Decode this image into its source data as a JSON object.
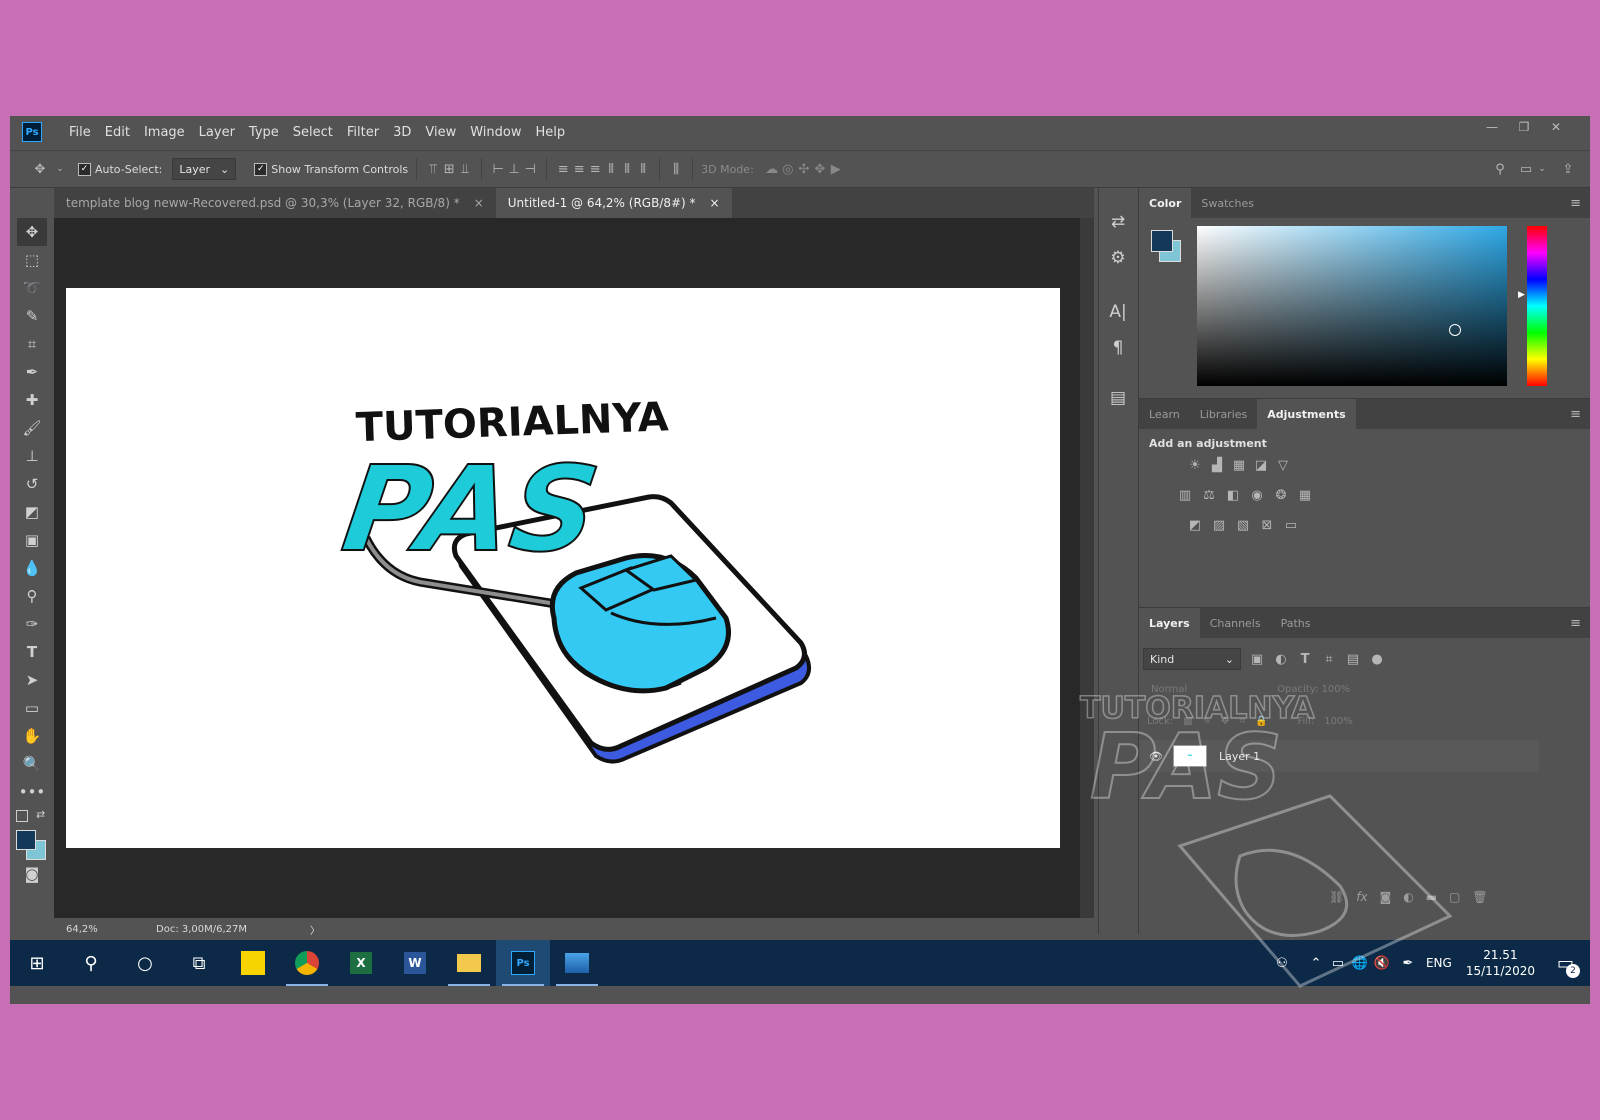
{
  "app": {
    "logo": "Ps"
  },
  "menu": [
    "File",
    "Edit",
    "Image",
    "Layer",
    "Type",
    "Select",
    "Filter",
    "3D",
    "View",
    "Window",
    "Help"
  ],
  "window_controls": {
    "minimize": "—",
    "restore": "❐",
    "close": "✕"
  },
  "options": {
    "auto_select_label": "Auto-Select:",
    "auto_select_value": "Layer",
    "transform_label": "Show Transform Controls",
    "mode_3d": "3D Mode:"
  },
  "tabs": [
    {
      "title": "template blog neww-Recovered.psd @ 30,3% (Layer 32, RGB/8) *",
      "close": "×"
    },
    {
      "title": "Untitled-1 @ 64,2% (RGB/8#) *",
      "close": "×"
    }
  ],
  "status": {
    "zoom": "64,2%",
    "doc": "Doc: 3,00M/6,27M",
    "arrow": "〉"
  },
  "canvas_art": {
    "line1": "TUTORIALNYA",
    "line2": "PAS"
  },
  "color_panel": {
    "tabs": [
      "Color",
      "Swatches"
    ],
    "fg": "#13385a",
    "bg": "#7ec6d6"
  },
  "adjust_panel": {
    "tabs": [
      "Learn",
      "Libraries",
      "Adjustments"
    ],
    "heading": "Add an adjustment"
  },
  "layers_panel": {
    "tabs": [
      "Layers",
      "Channels",
      "Paths"
    ],
    "kind": "Kind",
    "blend": "Normal",
    "opacity_label": "Opacity:",
    "opacity_value": "100%",
    "lock_label": "Lock:",
    "fill_label": "Fill:",
    "fill_value": "100%",
    "layer_name": "Layer 1"
  },
  "taskbar": {
    "lang": "ENG",
    "time": "21.51",
    "date": "15/11/2020",
    "notifications": "2"
  }
}
